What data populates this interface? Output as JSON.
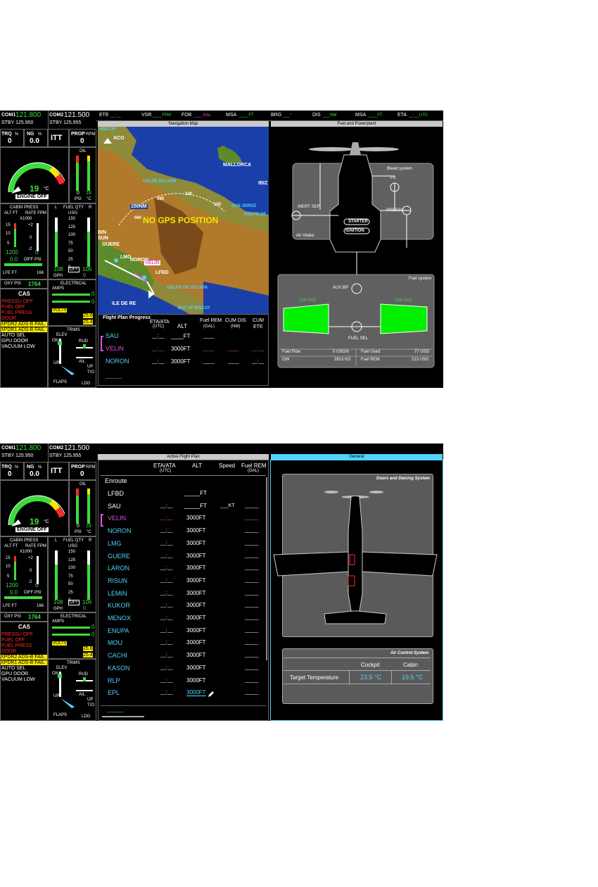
{
  "radios": {
    "com1_label": "COM1",
    "com1": "121.800",
    "stby1": "STBY 125.950",
    "com2_label": "COM2",
    "com2": "121.500",
    "stby2": "STBY 125.955"
  },
  "engine": {
    "trq_label": "TRQ",
    "trq_unit": "%",
    "trq": "0",
    "ng_label": "NG",
    "ng_unit": "%",
    "ng": "0.0",
    "itt": "ITT",
    "prop_label": "PROP",
    "prop_unit": "RPM",
    "prop": "0",
    "temp": "19",
    "temp_unit": "°C",
    "engine_off": "ENGINE OFF",
    "oil": "OIL",
    "oil_psi": "0",
    "oil_c": "18",
    "psi": "PSI",
    "degc": "°C"
  },
  "cabin": {
    "title": "CABIN PRESS",
    "alt_ft": "ALT FT",
    "rate_fpm": "RATE FPM",
    "x1000": "X1000",
    "ticks_l": [
      "15",
      "10",
      "5"
    ],
    "ticks_r": [
      "+2",
      "0",
      "-2"
    ],
    "alt": "1200",
    "rate": "0",
    "diff_val": "0.0",
    "diff": "DIFF PSI",
    "lfe": "LFE FT",
    "lfe_val": "166",
    "oxy": "OXY PSI",
    "oxy_val": "1764"
  },
  "fuel_qty": {
    "l": "L",
    "title": "FUEL QTY",
    "r": "R",
    "usg": "USG",
    "ticks": [
      "150",
      "125",
      "100",
      "75",
      "50",
      "25",
      "0"
    ],
    "left": "108",
    "off": "OFF",
    "right": "106",
    "gph": "GPH",
    "gph_val": "0"
  },
  "electrical": {
    "title": "ELECTRICAL",
    "amps": "AMPS",
    "amps1": "0",
    "amps2": "0",
    "volts": "VOLTS",
    "v1": "25.6",
    "v2": "25.4"
  },
  "cas": {
    "title": "CAS",
    "red": [
      "PRESSU OFF",
      "FUEL OFF",
      "FUEL PRESS",
      "DOOR"
    ],
    "yellow": [
      "XPDR2 ADS-B FAIL",
      "XPDR1 ADS-B FAIL"
    ],
    "white": [
      "AUTO SEL",
      "GPU DOOR",
      "VACUUM LOW"
    ]
  },
  "trims": {
    "title": "TRIMS",
    "elev": "ELEV",
    "on": "ON",
    "up": "UP",
    "rud": "RUD",
    "ail": "AIL",
    "flaps": "FLAPS",
    "up2": "UP",
    "to": "T/O",
    "ldg": "LDG"
  },
  "topbar": {
    "ete": "ETE",
    "ete_v": "__:__",
    "vsr": "VSR",
    "vsr_v": "____FPM",
    "fob": "FOB",
    "fob_v": "____GAL",
    "msa": "MSA",
    "msa_v": "____FT",
    "brg": "BRG",
    "brg_v": "___°",
    "dis": "DIS",
    "dis_v": "___NM",
    "msa2": "MSA",
    "msa2_v": "____FT",
    "eta": "ETA",
    "eta_v": "__:__UTC"
  },
  "navmap": {
    "title": "Navigation Map",
    "hdg": "HDG UP",
    "places": [
      "MALLORCA",
      "GOLFE DU LION",
      "IBIZ",
      "SAN JORGE",
      "GOLFO DE",
      "ACO",
      "BIN",
      "SUN",
      "GUERE",
      "LMG",
      "NORON",
      "VELIN",
      "LFBD",
      "GOLFO DE VIZCAYA",
      "ILE DE RE",
      "BAY OF BISCAY"
    ],
    "range": "150NM",
    "hdg_ticks": [
      "090",
      "120",
      "150",
      "060"
    ],
    "no_gps": "NO GPS POSITION"
  },
  "fpp": {
    "title": "Flight Plan Progress",
    "col1": "ETA/ATA",
    "col1b": "(UTC)",
    "col2": "ALT",
    "col3": "Fuel REM",
    "col3b": "(GAL)",
    "col4": "CUM DIS",
    "col4b": "(NM)",
    "col5": "CUM",
    "col5b": "ETE",
    "rows": [
      {
        "wp": "SAU",
        "eta": "__:__",
        "alt": "____FT",
        "fuel": "____",
        "dis": "",
        "ete": ""
      },
      {
        "wp": "VELIN",
        "eta": "__:__",
        "alt": "3000FT",
        "fuel": "____",
        "dis": "____",
        "ete": "__:__"
      },
      {
        "wp": "NORON",
        "eta": "__:__",
        "alt": "3000FT",
        "fuel": "____",
        "dis": "____",
        "ete": "__:__"
      }
    ],
    "bottom": "______"
  },
  "fuelpp": {
    "title": "Fuel and Powerplant",
    "bleed": "Bleed system",
    "p3": "P3",
    "inert": "INERT SEP",
    "pressu": "PRESSU",
    "starter": "STARTER",
    "ignition": "IGNITION",
    "intake": "Air Intake",
    "fuelsys": "Fuel system",
    "auxbp": "AUX BP",
    "left_usg": "108 USG",
    "right_usg": "106 USG",
    "fuelsel": "FUEL SEL",
    "ff_l": "Fuel Flow",
    "ff_v": "0 USG/h",
    "gw_l": "GW",
    "gw_v": "2813 KG",
    "fu_l": "Fuel Used",
    "fu_v": "77 USG",
    "fr_l": "Fuel REM",
    "fr_v": "213 USG"
  },
  "afp": {
    "title": "Active Flight Plan",
    "col1": "ETA/ATA",
    "col1b": "(UTC)",
    "col2": "ALT",
    "col3": "Speed",
    "col4": "Fuel REM",
    "col4b": "(GAL)",
    "enroute": "Enroute",
    "rows": [
      {
        "wp": "LFBD",
        "eta": "",
        "alt": "_____FT",
        "spd": "",
        "fuel": ""
      },
      {
        "wp": "SAU",
        "eta": "__:__",
        "alt": "_____FT",
        "spd": "___KT",
        "fuel": "_____"
      },
      {
        "wp": "VELIN",
        "eta": "__:__",
        "alt": "3000FT",
        "spd": "",
        "fuel": "_____"
      },
      {
        "wp": "NORON",
        "eta": "__:__",
        "alt": "3000FT",
        "spd": "",
        "fuel": "_____"
      },
      {
        "wp": "LMG",
        "eta": "__:__",
        "alt": "3000FT",
        "spd": "",
        "fuel": "_____"
      },
      {
        "wp": "GUERE",
        "eta": "__:__",
        "alt": "3000FT",
        "spd": "",
        "fuel": "_____"
      },
      {
        "wp": "LARON",
        "eta": "__:__",
        "alt": "3000FT",
        "spd": "",
        "fuel": "_____"
      },
      {
        "wp": "RISUN",
        "eta": "__:__",
        "alt": "3000FT",
        "spd": "",
        "fuel": "_____"
      },
      {
        "wp": "LEMIN",
        "eta": "__:__",
        "alt": "3000FT",
        "spd": "",
        "fuel": "_____"
      },
      {
        "wp": "KUKOR",
        "eta": "__:__",
        "alt": "3000FT",
        "spd": "",
        "fuel": "_____"
      },
      {
        "wp": "MENOX",
        "eta": "__:__",
        "alt": "3000FT",
        "spd": "",
        "fuel": "_____"
      },
      {
        "wp": "ENUPA",
        "eta": "__:__",
        "alt": "3000FT",
        "spd": "",
        "fuel": "_____"
      },
      {
        "wp": "MOU",
        "eta": "__:__",
        "alt": "3000FT",
        "spd": "",
        "fuel": "_____"
      },
      {
        "wp": "CACHI",
        "eta": "__:__",
        "alt": "3000FT",
        "spd": "",
        "fuel": "_____"
      },
      {
        "wp": "KASON",
        "eta": "__:__",
        "alt": "3000FT",
        "spd": "",
        "fuel": "_____"
      },
      {
        "wp": "RLP",
        "eta": "__:__",
        "alt": "3000FT",
        "spd": "",
        "fuel": "_____"
      },
      {
        "wp": "EPL",
        "eta": "__:__",
        "alt": "3000FT",
        "spd": "",
        "fuel": "_____"
      }
    ],
    "bottom": "______"
  },
  "general": {
    "title": "General",
    "doors": "Doors and Deicing System",
    "air": "Air Control System",
    "cockpit": "Cockpit",
    "cabin": "Cabin",
    "target": "Target Temperature",
    "cockpit_v": "23.5 °C",
    "cabin_v": "19.5 °C"
  }
}
